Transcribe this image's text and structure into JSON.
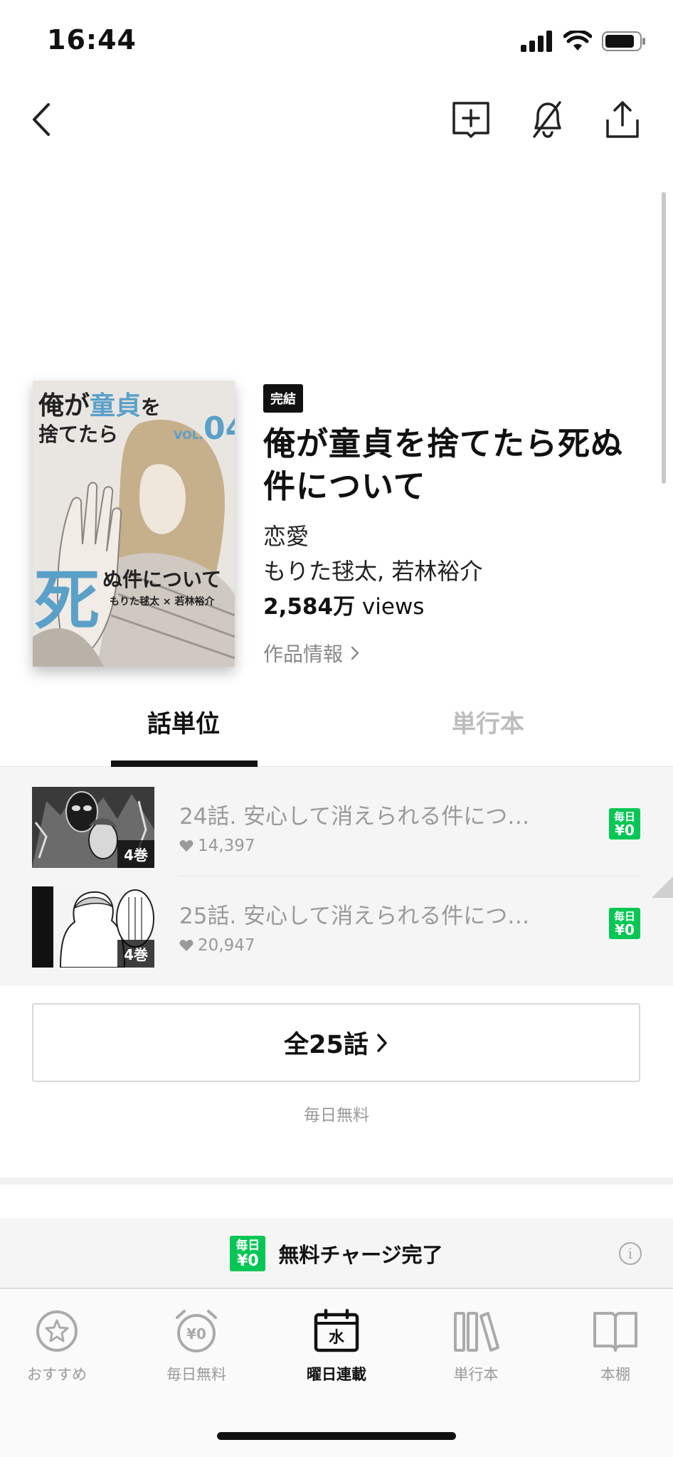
{
  "status_bar": {
    "time": "16:44"
  },
  "nav": {
    "back": "back-icon",
    "actions": [
      "add-bookshelf-icon",
      "notification-off-icon",
      "share-icon"
    ]
  },
  "series": {
    "badge": "完結",
    "title": "俺が童貞を捨てたら死ぬ件について",
    "genre": "恋愛",
    "authors": "もりた毬太, 若林裕介",
    "views_number": "2,584",
    "views_unit": "万",
    "views_suffix": "views",
    "work_info_label": "作品情報",
    "cover": {
      "title_line1_a": "俺が",
      "title_line1_b": "童貞",
      "title_line1_c": "を",
      "title_line2": "捨てたら",
      "vol": "VOL.",
      "vol_number": "04",
      "big_char": "死",
      "title_line3": "ぬ件について",
      "authors": "もりた毬太 × 若林裕介"
    }
  },
  "tabs": [
    {
      "label": "話単位",
      "active": true
    },
    {
      "label": "単行本",
      "active": false
    }
  ],
  "episodes": [
    {
      "title": "24話. 安心して消えられる件につ…",
      "likes": "14,397",
      "volume": "4巻",
      "badge_top": "毎日",
      "badge_bottom": "¥0"
    },
    {
      "title": "25話. 安心して消えられる件につ…",
      "likes": "20,947",
      "volume": "4巻",
      "badge_top": "毎日",
      "badge_bottom": "¥0"
    }
  ],
  "all_episodes_button": "全25話",
  "daily_free_caption": "毎日無料",
  "charge_banner": {
    "badge_top": "毎日",
    "badge_bottom": "¥0",
    "text": "無料チャージ完了",
    "info": "i"
  },
  "bottom_nav": [
    {
      "label": "おすすめ",
      "icon": "star-badge-icon",
      "active": false
    },
    {
      "label": "毎日無料",
      "icon": "alarm-clock-yen-icon",
      "active": false
    },
    {
      "label": "曜日連載",
      "icon": "calendar-weekday-icon",
      "active": true,
      "icon_text": "水"
    },
    {
      "label": "単行本",
      "icon": "books-icon",
      "active": false
    },
    {
      "label": "本棚",
      "icon": "open-book-icon",
      "active": false
    }
  ],
  "colors": {
    "accent_green": "#06c755",
    "text_primary": "#111111",
    "text_muted": "#9a9a9a"
  }
}
